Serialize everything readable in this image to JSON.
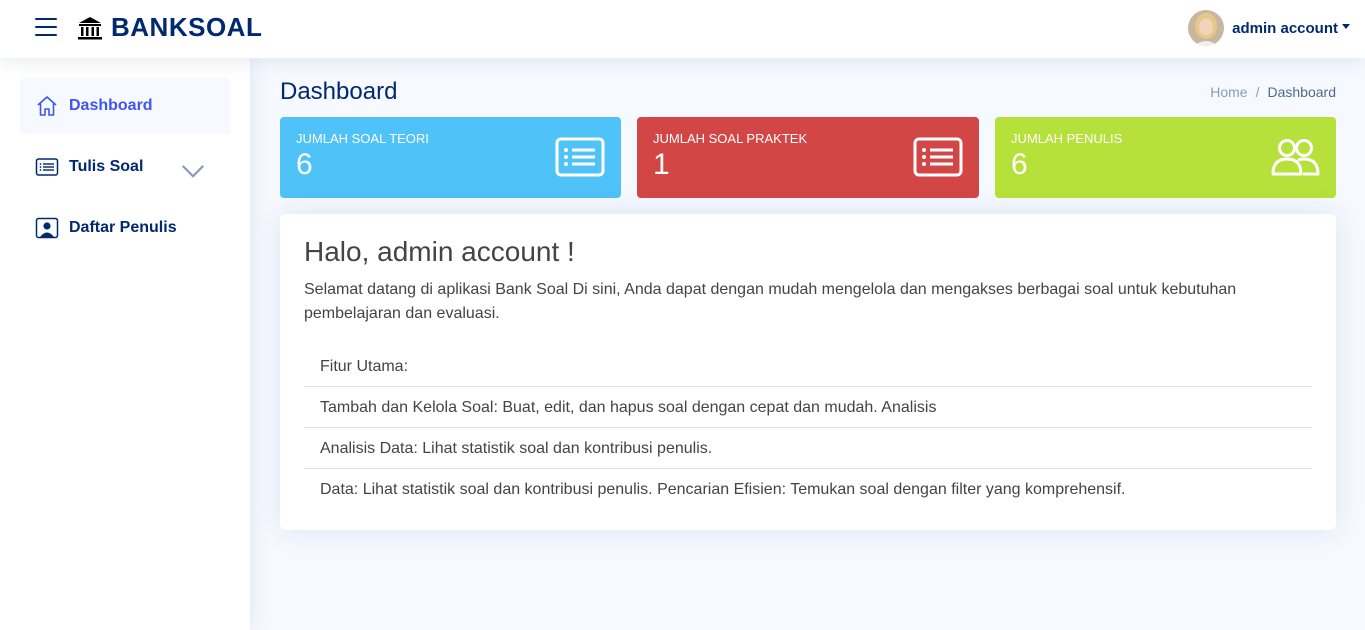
{
  "header": {
    "logo_text": "BANKSOAL",
    "user_name": "admin account"
  },
  "sidebar": {
    "items": [
      {
        "label": "Dashboard",
        "icon": "house-icon",
        "active": true
      },
      {
        "label": "Tulis Soal",
        "icon": "list-icon",
        "expandable": true
      },
      {
        "label": "Daftar Penulis",
        "icon": "person-badge-icon"
      }
    ]
  },
  "page": {
    "title": "Dashboard",
    "breadcrumb": [
      "Home",
      "Dashboard"
    ]
  },
  "stats": [
    {
      "label": "JUMLAH SOAL TEORI",
      "value": "6",
      "color": "#4fc2f7",
      "icon": "list-card-icon"
    },
    {
      "label": "JUMLAH SOAL PRAKTEK",
      "value": "1",
      "color": "#d24646",
      "icon": "list-card-icon"
    },
    {
      "label": "JUMLAH PENULIS",
      "value": "6",
      "color": "#b6e03a",
      "icon": "people-icon"
    }
  ],
  "welcome": {
    "heading": "Halo, admin account !",
    "intro": "Selamat datang di aplikasi Bank Soal Di sini, Anda dapat dengan mudah mengelola dan mengakses berbagai soal untuk kebutuhan pembelajaran dan evaluasi.",
    "features": [
      "Fitur Utama:",
      "Tambah dan Kelola Soal: Buat, edit, dan hapus soal dengan cepat dan mudah. Analisis",
      "Analisis Data: Lihat statistik soal dan kontribusi penulis.",
      "Data: Lihat statistik soal dan kontribusi penulis. Pencarian Efisien: Temukan soal dengan filter yang komprehensif."
    ]
  }
}
